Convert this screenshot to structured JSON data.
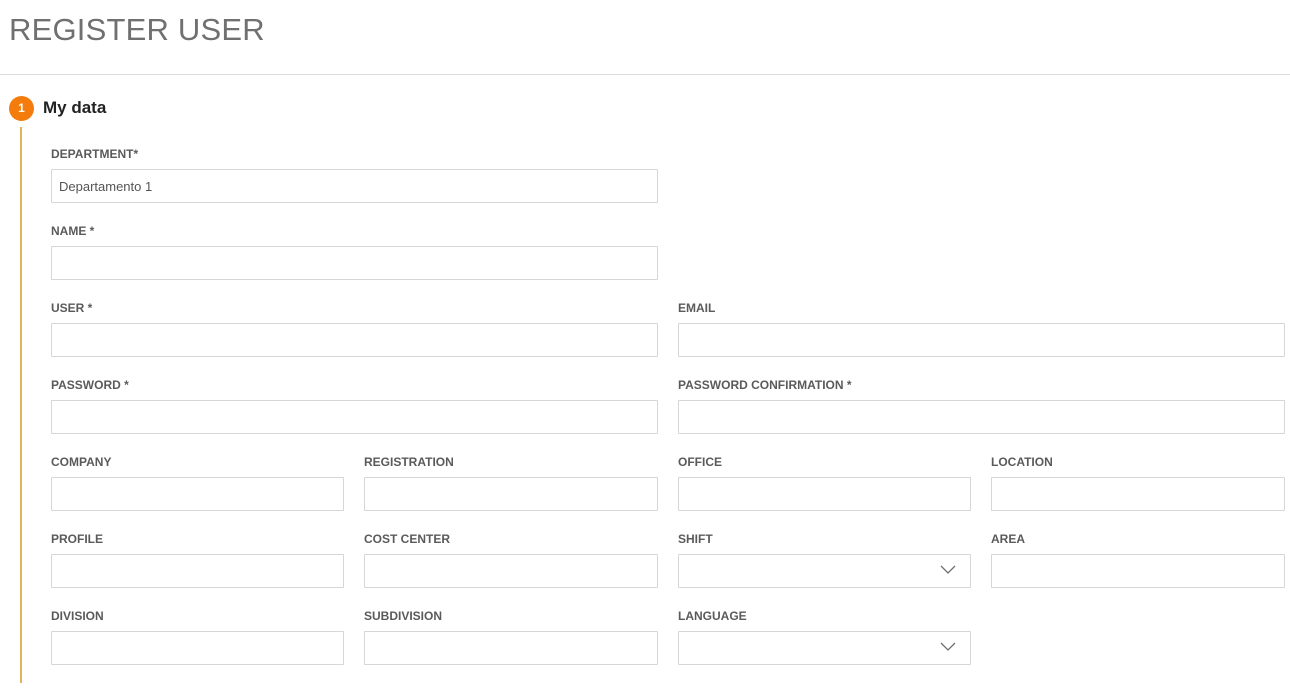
{
  "page": {
    "title": "REGISTER USER"
  },
  "step": {
    "number": "1",
    "title": "My data"
  },
  "fields": {
    "department": {
      "label": "DEPARTMENT*",
      "value": "Departamento 1"
    },
    "name": {
      "label": "NAME *",
      "value": ""
    },
    "user": {
      "label": "USER *",
      "value": ""
    },
    "email": {
      "label": "EMAIL",
      "value": ""
    },
    "password": {
      "label": "PASSWORD *",
      "value": ""
    },
    "password_confirmation": {
      "label": "PASSWORD CONFIRMATION *",
      "value": ""
    },
    "company": {
      "label": "COMPANY",
      "value": ""
    },
    "registration": {
      "label": "REGISTRATION",
      "value": ""
    },
    "office": {
      "label": "OFFICE",
      "value": ""
    },
    "location": {
      "label": "LOCATION",
      "value": ""
    },
    "profile": {
      "label": "PROFILE",
      "value": ""
    },
    "cost_center": {
      "label": "COST CENTER",
      "value": ""
    },
    "shift": {
      "label": "SHIFT",
      "value": "",
      "icon": "chevron-down-icon"
    },
    "area": {
      "label": "AREA",
      "value": ""
    },
    "division": {
      "label": "DIVISION",
      "value": ""
    },
    "subdivision": {
      "label": "SUBDIVISION",
      "value": ""
    },
    "language": {
      "label": "LANGUAGE",
      "value": "",
      "icon": "chevron-down-icon"
    }
  },
  "colors": {
    "accent": "#f47c0c",
    "step_line": "#e3b25c",
    "title": "#707070",
    "border": "#d6d6d6"
  }
}
